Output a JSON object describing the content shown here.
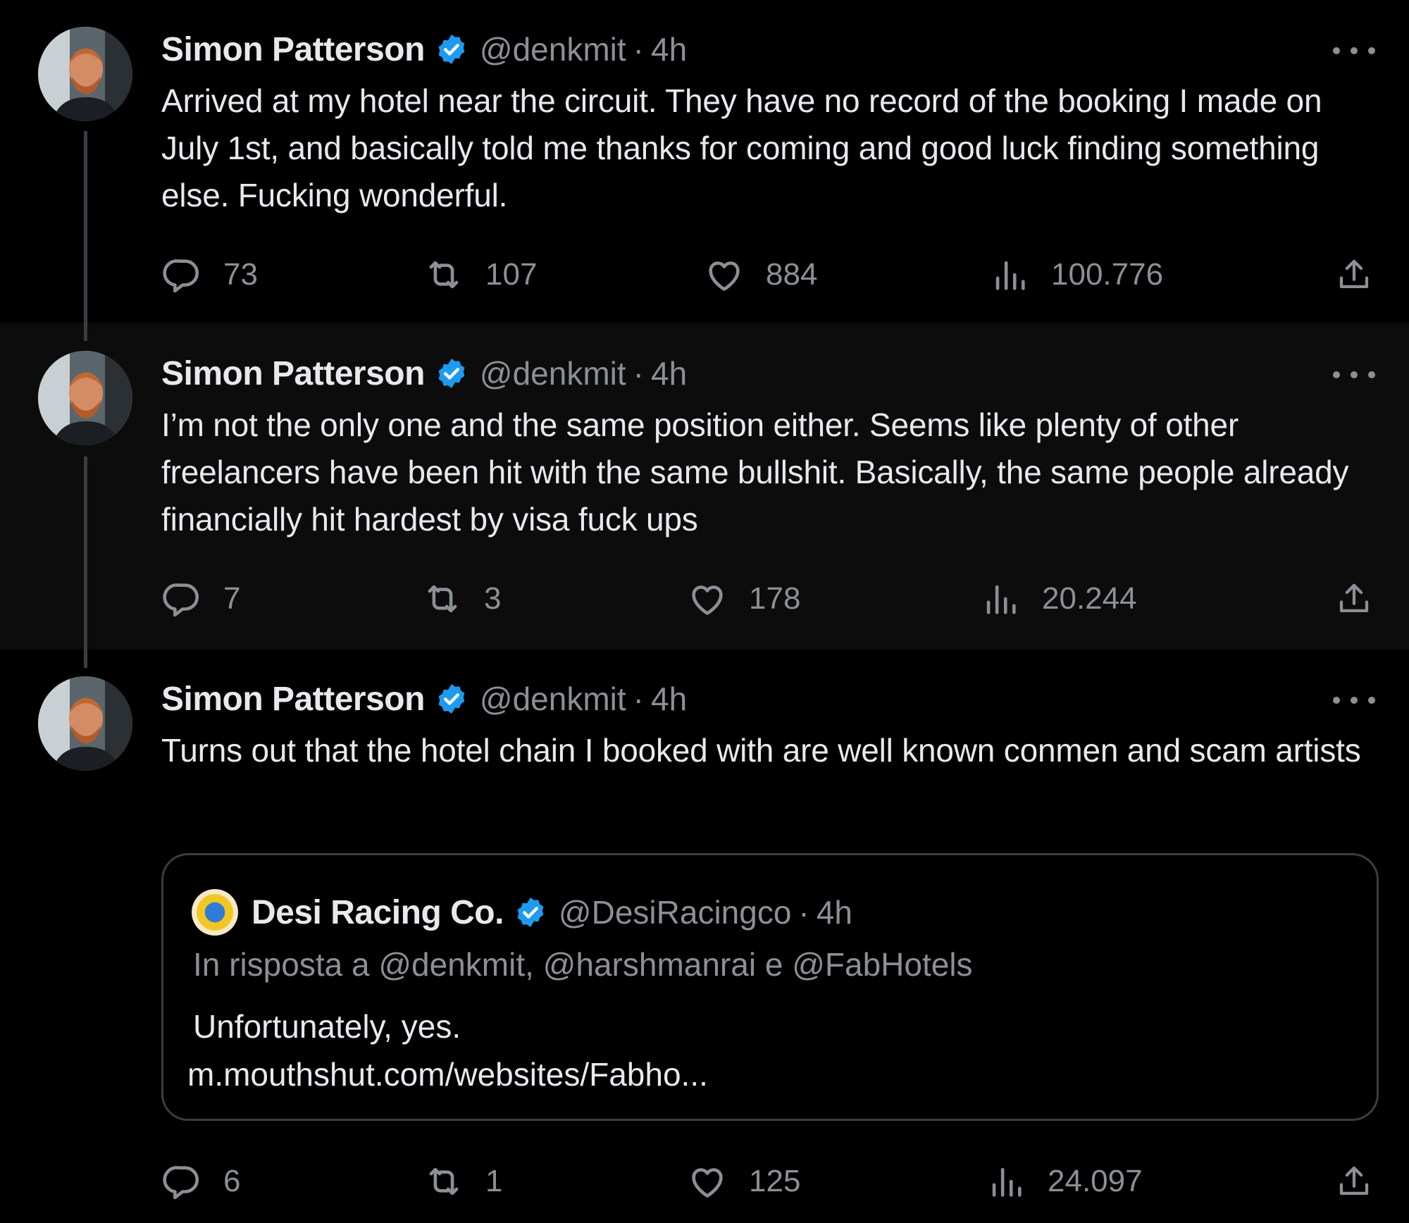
{
  "colors": {
    "background": "#000000",
    "highlight_row": "#0c0c0c",
    "text": "#e7e9ea",
    "muted": "#8b9096",
    "verified": "#1d9bf0"
  },
  "tweets": [
    {
      "author": {
        "name": "Simon Patterson",
        "handle": "@denkmit",
        "avatar_icon": "avatar-photo",
        "verified": true
      },
      "sep": "·",
      "time": "4h",
      "text": "Arrived at my hotel near the circuit. They have no record of the booking I made on July 1st, and basically told me thanks for coming and good luck finding something else. Fucking wonderful.",
      "stats": {
        "replies": "73",
        "retweets": "107",
        "likes": "884",
        "views": "100.776"
      }
    },
    {
      "author": {
        "name": "Simon Patterson",
        "handle": "@denkmit",
        "avatar_icon": "avatar-photo",
        "verified": true
      },
      "sep": "·",
      "time": "4h",
      "text": "I’m not the only one and the same position either. Seems like plenty of other freelancers have been hit with the same bullshit. Basically, the same people already financially hit hardest by visa fuck ups",
      "stats": {
        "replies": "7",
        "retweets": "3",
        "likes": "178",
        "views": "20.244"
      }
    },
    {
      "author": {
        "name": "Simon Patterson",
        "handle": "@denkmit",
        "avatar_icon": "avatar-photo",
        "verified": true
      },
      "sep": "·",
      "time": "4h",
      "text": "Turns out that the hotel chain I booked with are well known conmen and scam artists",
      "quote": {
        "author": {
          "name": "Desi Racing Co.",
          "handle": "@DesiRacingco",
          "verified": true
        },
        "sep": "·",
        "time": "4h",
        "reply_to": "In risposta a @denkmit, @harshmanrai e @FabHotels",
        "text": "Unfortunately, yes.",
        "link": "m.mouthshut.com/websites/Fabho..."
      },
      "stats": {
        "replies": "6",
        "retweets": "1",
        "likes": "125",
        "views": "24.097"
      }
    }
  ]
}
